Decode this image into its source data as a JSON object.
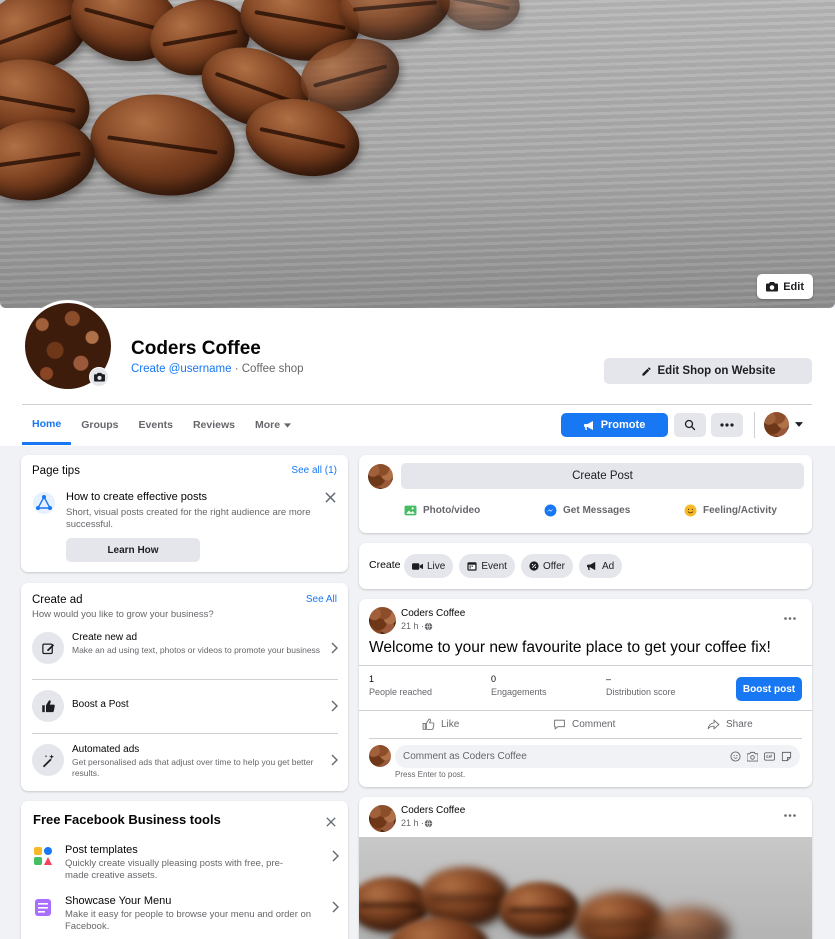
{
  "cover": {
    "edit_label": "Edit"
  },
  "profile": {
    "name": "Coders Coffee",
    "username_link": "Create @username",
    "category": " · Coffee shop",
    "edit_shop_label": "Edit Shop on Website"
  },
  "tabs": [
    {
      "label": "Home",
      "active": true
    },
    {
      "label": "Groups"
    },
    {
      "label": "Events"
    },
    {
      "label": "Reviews"
    },
    {
      "label": "More"
    }
  ],
  "actions": {
    "promote_label": "Promote"
  },
  "page_tips": {
    "title": "Page tips",
    "see_all": "See all (1)",
    "tip_title": "How to create effective posts",
    "tip_desc": "Short, visual posts created for the right audience are more successful.",
    "button": "Learn How"
  },
  "create_ad": {
    "title": "Create ad",
    "subtitle": "How would you like to grow your business?",
    "see_all": "See All",
    "items": [
      {
        "title": "Create new ad",
        "desc": "Make an ad using text, photos or videos to promote your business"
      },
      {
        "title": "Boost a Post",
        "desc": ""
      },
      {
        "title": "Automated ads",
        "desc": "Get personalised ads that adjust over time to help you get better results."
      }
    ]
  },
  "tools": {
    "title": "Free Facebook Business tools",
    "items": [
      {
        "title": "Post templates",
        "desc": "Quickly create visually pleasing posts with free, pre-made creative assets."
      },
      {
        "title": "Showcase Your Menu",
        "desc": "Make it easy for people to browse your menu and order on Facebook."
      }
    ]
  },
  "composer": {
    "create_post": "Create Post",
    "photo_video": "Photo/video",
    "get_messages": "Get Messages",
    "feeling": "Feeling/Activity"
  },
  "create_bar": {
    "label": "Create",
    "chips": [
      "Live",
      "Event",
      "Offer",
      "Ad"
    ]
  },
  "post1": {
    "author": "Coders Coffee",
    "time": "21 h · ",
    "text": "Welcome to your new favourite place to get your coffee fix!",
    "stats": [
      {
        "value": "1",
        "label": "People reached"
      },
      {
        "value": "0",
        "label": "Engagements"
      },
      {
        "value": "–",
        "label": "Distribution score"
      }
    ],
    "boost_label": "Boost post",
    "like": "Like",
    "comment": "Comment",
    "share": "Share",
    "comment_placeholder": "Comment as Coders Coffee",
    "press_enter": "Press Enter to post."
  },
  "post2": {
    "author": "Coders Coffee",
    "time": "21 h · "
  },
  "colors": {
    "accent": "#1877f2",
    "background": "#f0f2f5"
  }
}
